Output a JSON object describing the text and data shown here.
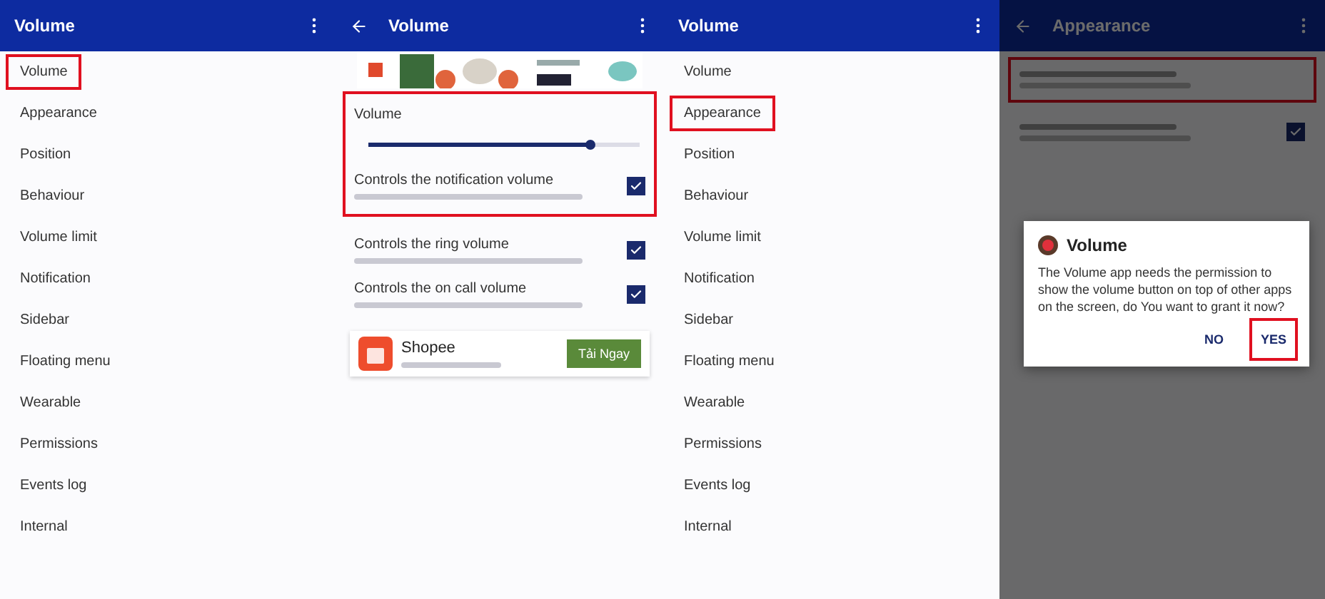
{
  "menu_left": {
    "title": "Volume",
    "items": [
      {
        "label": "Volume",
        "highlighted": true
      },
      {
        "label": "Appearance",
        "highlighted": false
      },
      {
        "label": "Position",
        "highlighted": false
      },
      {
        "label": "Behaviour",
        "highlighted": false
      },
      {
        "label": "Volume limit",
        "highlighted": false
      },
      {
        "label": "Notification",
        "highlighted": false
      },
      {
        "label": "Sidebar",
        "highlighted": false
      },
      {
        "label": "Floating menu",
        "highlighted": false
      },
      {
        "label": "Wearable",
        "highlighted": false
      },
      {
        "label": "Permissions",
        "highlighted": false
      },
      {
        "label": "Events log",
        "highlighted": false
      },
      {
        "label": "Internal",
        "highlighted": false
      }
    ]
  },
  "volume_settings": {
    "title": "Volume",
    "sections": [
      {
        "highlighted": true,
        "rows": [
          {
            "kind": "slider",
            "label": "Volume",
            "level": 0.82
          },
          {
            "kind": "check",
            "label": "Controls the notification volume",
            "checked": true
          }
        ]
      },
      {
        "highlighted": false,
        "rows": [
          {
            "kind": "check",
            "label": "Controls the ring volume",
            "checked": true
          },
          {
            "kind": "check",
            "label": "Controls the on call volume",
            "checked": true
          }
        ]
      }
    ],
    "ad": {
      "name": "Shopee",
      "button": "Tải Ngay"
    }
  },
  "menu_right": {
    "title": "Volume",
    "items": [
      {
        "label": "Volume",
        "highlighted": false
      },
      {
        "label": "Appearance",
        "highlighted": true
      },
      {
        "label": "Position",
        "highlighted": false
      },
      {
        "label": "Behaviour",
        "highlighted": false
      },
      {
        "label": "Volume limit",
        "highlighted": false
      },
      {
        "label": "Notification",
        "highlighted": false
      },
      {
        "label": "Sidebar",
        "highlighted": false
      },
      {
        "label": "Floating menu",
        "highlighted": false
      },
      {
        "label": "Wearable",
        "highlighted": false
      },
      {
        "label": "Permissions",
        "highlighted": false
      },
      {
        "label": "Events log",
        "highlighted": false
      },
      {
        "label": "Internal",
        "highlighted": false
      }
    ]
  },
  "appearance_screen": {
    "title": "Appearance",
    "dimmed": true,
    "rows": [
      {
        "highlighted": true
      },
      {
        "highlighted": false,
        "checked": true
      }
    ],
    "dialog": {
      "title": "Volume",
      "message": "The Volume app needs the permission to show the volume button on top of other apps on the screen, do You want to grant it now?",
      "buttons": [
        {
          "label": "NO",
          "highlighted": false
        },
        {
          "label": "YES",
          "highlighted": true
        }
      ]
    }
  }
}
